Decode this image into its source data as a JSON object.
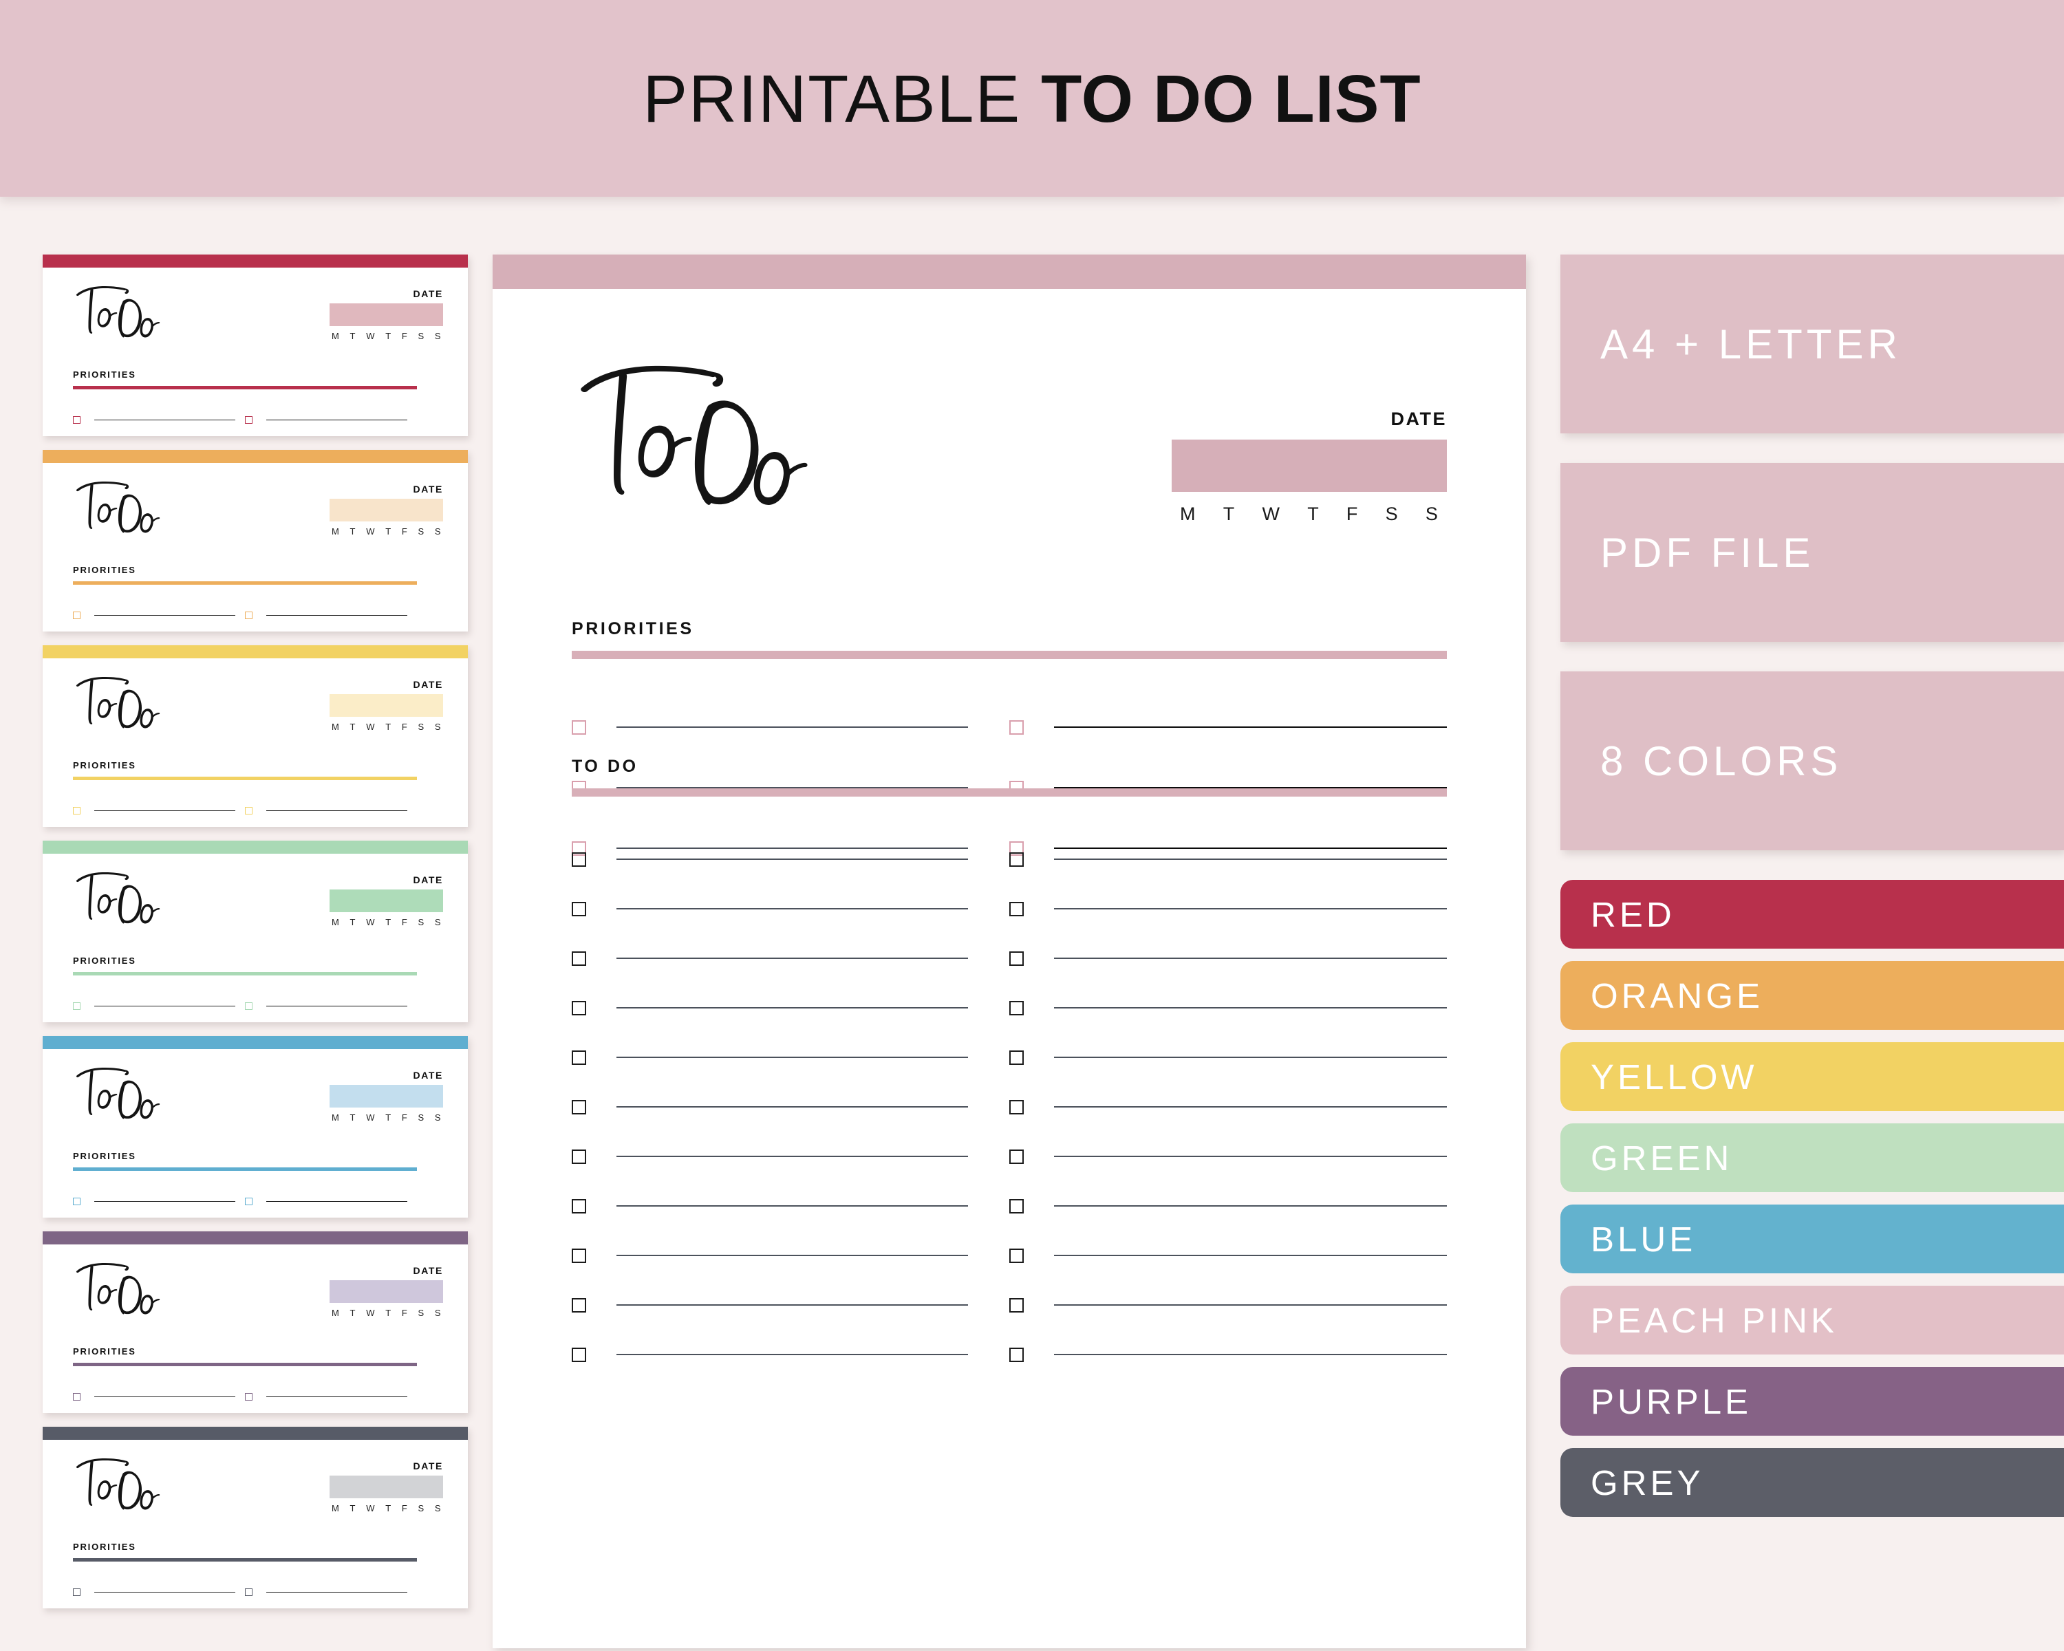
{
  "header": {
    "title_light": "PRINTABLE ",
    "title_bold": "TO DO LIST",
    "background": "#E2C3CB"
  },
  "page_background": "#F7F0EF",
  "main_preview": {
    "topbar_color": "#D6AFB8",
    "logo_text": "To Do",
    "date_label": "DATE",
    "date_box_color": "#D6AFB8",
    "days": [
      "M",
      "T",
      "W",
      "T",
      "F",
      "S",
      "S"
    ],
    "priorities": {
      "label": "PRIORITIES",
      "rule_color": "#D8AFB8",
      "checkbox_color": "#D99FAD",
      "row_count": 3,
      "columns": 2,
      "left_line_color": "#4c525c",
      "right_line_color": "#0b0b0b"
    },
    "todo": {
      "label": "TO DO",
      "rule_color": "#D8AFB8",
      "checkbox_color": "#1b1b1b",
      "row_count": 11,
      "columns": 2,
      "left_line_color": "#4c525c",
      "right_line_color": "#4c525c"
    }
  },
  "thumbnails": [
    {
      "name": "red",
      "bar_color": "#B8304C",
      "date_box_color": "#E0B8BE",
      "rule_color": "#B8304C",
      "checkbox_color": "#B8304C",
      "date_label": "DATE",
      "priorities_label": "PRIORITIES",
      "logo_text": "To Do"
    },
    {
      "name": "orange",
      "bar_color": "#EDAE5C",
      "date_box_color": "#F8E4CB",
      "rule_color": "#EDAE5C",
      "checkbox_color": "#EDAE5C",
      "date_label": "DATE",
      "priorities_label": "PRIORITIES",
      "logo_text": "To Do"
    },
    {
      "name": "yellow",
      "bar_color": "#F2D263",
      "date_box_color": "#FBEDC8",
      "rule_color": "#F2D263",
      "checkbox_color": "#F2D263",
      "date_label": "DATE",
      "priorities_label": "PRIORITIES",
      "logo_text": "To Do"
    },
    {
      "name": "green",
      "bar_color": "#A9D9B5",
      "date_box_color": "#AEDCB9",
      "rule_color": "#A9D9B5",
      "checkbox_color": "#A9D9B5",
      "date_label": "DATE",
      "priorities_label": "PRIORITIES",
      "logo_text": "To Do"
    },
    {
      "name": "blue",
      "bar_color": "#5FAED0",
      "date_box_color": "#C3DEEE",
      "rule_color": "#5FAED0",
      "checkbox_color": "#5FAED0",
      "date_label": "DATE",
      "priorities_label": "PRIORITIES",
      "logo_text": "To Do"
    },
    {
      "name": "purple",
      "bar_color": "#7E6585",
      "date_box_color": "#CFC7DC",
      "rule_color": "#7E6585",
      "checkbox_color": "#7E6585",
      "date_label": "DATE",
      "priorities_label": "PRIORITIES",
      "logo_text": "To Do"
    },
    {
      "name": "grey",
      "bar_color": "#575B67",
      "date_box_color": "#D2D3D6",
      "rule_color": "#575B67",
      "checkbox_color": "#575B67",
      "date_label": "DATE",
      "priorities_label": "PRIORITIES",
      "logo_text": "To Do"
    }
  ],
  "badges": [
    {
      "label": "A4 + LETTER",
      "color": "#DFBFC6"
    },
    {
      "label": "PDF FILE",
      "color": "#DFBFC6"
    },
    {
      "label": "8 COLORS",
      "color": "#DFBFC6"
    }
  ],
  "swatches": [
    {
      "label": "RED",
      "color": "#B8304C"
    },
    {
      "label": "ORANGE",
      "color": "#EDAE5C"
    },
    {
      "label": "YELLOW",
      "color": "#F2D263"
    },
    {
      "label": "GREEN",
      "color": "#BFE0BF"
    },
    {
      "label": "BLUE",
      "color": "#63B2CE"
    },
    {
      "label": "PEACH PINK",
      "color": "#E3C0C7"
    },
    {
      "label": "PURPLE",
      "color": "#866286"
    },
    {
      "label": "GREY",
      "color": "#5C5E68"
    }
  ]
}
